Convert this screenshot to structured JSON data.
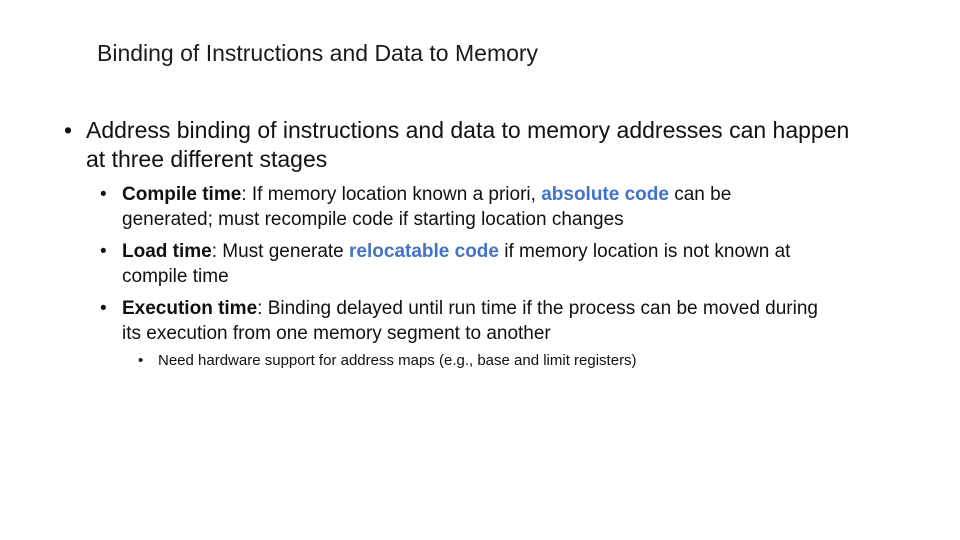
{
  "slide": {
    "title": "Binding of Instructions and Data to Memory",
    "bullet_char": "•",
    "main_bullet": "Address binding of instructions and data to memory addresses can happen at three different stages",
    "stages": [
      {
        "term": "Compile time",
        "sep": ":  If memory location known a priori, ",
        "highlight": "absolute code",
        "rest": " can be generated; must recompile code if starting location changes"
      },
      {
        "term": "Load time",
        "sep": ":  Must generate ",
        "highlight": "relocatable code",
        "rest": " if memory location is not known at compile time"
      },
      {
        "term": "Execution time",
        "sep": ":  Binding delayed until run time if the process can be moved during its execution from one memory segment to another",
        "highlight": "",
        "rest": ""
      }
    ],
    "sub_bullet": "Need hardware support for address maps (e.g., base and limit registers)",
    "colors": {
      "highlight": "#4472c4",
      "text": "#111111"
    }
  }
}
